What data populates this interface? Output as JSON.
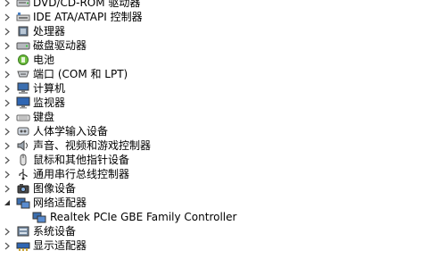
{
  "tree": {
    "items": [
      {
        "label": "DVD/CD-ROM 驱动器",
        "icon": "optical-drive-icon",
        "expanded": false
      },
      {
        "label": "IDE ATA/ATAPI 控制器",
        "icon": "ide-controller-icon",
        "expanded": false
      },
      {
        "label": "处理器",
        "icon": "processor-icon",
        "expanded": false
      },
      {
        "label": "磁盘驱动器",
        "icon": "disk-drive-icon",
        "expanded": false
      },
      {
        "label": "电池",
        "icon": "battery-icon",
        "expanded": false
      },
      {
        "label": "端口 (COM 和 LPT)",
        "icon": "port-icon",
        "expanded": false
      },
      {
        "label": "计算机",
        "icon": "computer-icon",
        "expanded": false
      },
      {
        "label": "监视器",
        "icon": "monitor-icon",
        "expanded": false
      },
      {
        "label": "键盘",
        "icon": "keyboard-icon",
        "expanded": false
      },
      {
        "label": "人体学输入设备",
        "icon": "hid-icon",
        "expanded": false
      },
      {
        "label": "声音、视频和游戏控制器",
        "icon": "sound-icon",
        "expanded": false
      },
      {
        "label": "鼠标和其他指针设备",
        "icon": "mouse-icon",
        "expanded": false
      },
      {
        "label": "通用串行总线控制器",
        "icon": "usb-icon",
        "expanded": false
      },
      {
        "label": "图像设备",
        "icon": "imaging-device-icon",
        "expanded": false
      },
      {
        "label": "网络适配器",
        "icon": "network-adapter-icon",
        "expanded": true
      },
      {
        "label": "Realtek PCIe GBE Family Controller",
        "icon": "network-card-icon",
        "child": true
      },
      {
        "label": "系统设备",
        "icon": "system-device-icon",
        "expanded": false
      },
      {
        "label": "显示适配器",
        "icon": "display-adapter-icon",
        "expanded": false
      }
    ]
  }
}
